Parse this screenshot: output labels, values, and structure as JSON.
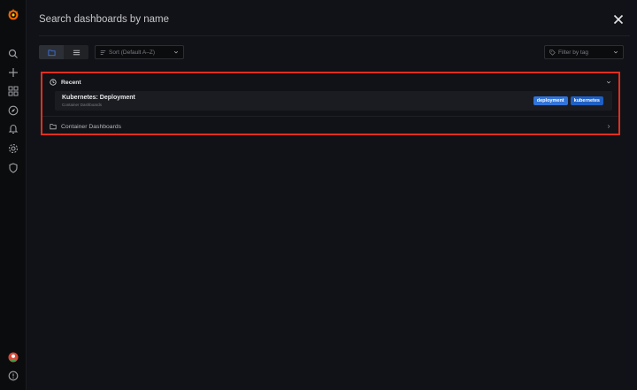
{
  "search": {
    "placeholder": "Search dashboards by name",
    "value": ""
  },
  "toolbar": {
    "sort_label": "Sort (Default A–Z)",
    "tag_filter_placeholder": "Filter by tag",
    "view_modes": [
      "folder-view",
      "list-view"
    ],
    "active_view": "folder-view"
  },
  "sections": {
    "recent": {
      "title": "Recent",
      "items": [
        {
          "title": "Kubernetes: Deployment",
          "folder": "Container Dashboards",
          "tags": [
            "deployment",
            "kubernetes"
          ]
        }
      ]
    },
    "container": {
      "title": "Container Dashboards"
    }
  },
  "sidebar": {
    "icons": [
      "grafana-logo-icon",
      "search-icon",
      "plus-icon",
      "dashboards-icon",
      "explore-icon",
      "alerting-icon",
      "configuration-icon",
      "shield-icon",
      "user-avatar-icon",
      "help-icon"
    ]
  },
  "colors": {
    "background": "#111217",
    "sidebar": "#0b0c0e",
    "highlight_border": "#e02f1f",
    "accent_blue": "#3d71d9",
    "tag_deployment": "#3274d9",
    "tag_kubernetes": "#1f60c4",
    "logo_orange": "#f46800"
  }
}
